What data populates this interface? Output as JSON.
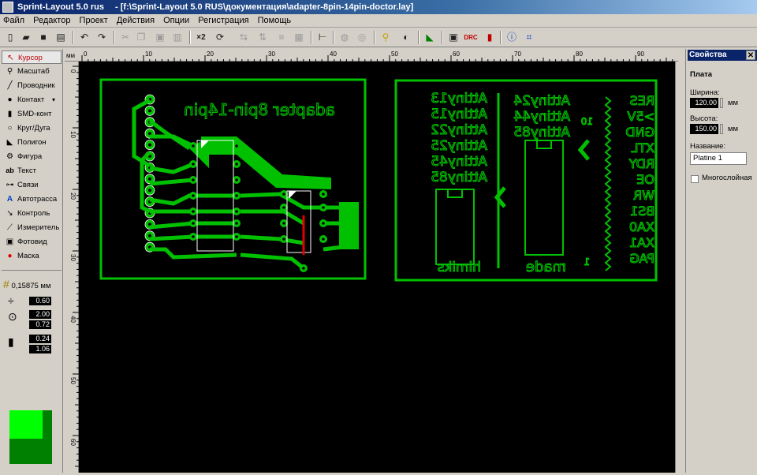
{
  "window": {
    "app_name": "Sprint-Layout 5.0 rus",
    "document_path": "- [f:\\Sprint-Layout 5.0 RUS\\документация\\adapter-8pin-14pin-doctor.lay]"
  },
  "menu": [
    "Файл",
    "Редактор",
    "Проект",
    "Действия",
    "Опции",
    "Регистрация",
    "Помощь"
  ],
  "tools": [
    {
      "label": "Курсор",
      "icon": "cursor-icon"
    },
    {
      "label": "Масштаб",
      "icon": "zoom-icon"
    },
    {
      "label": "Проводник",
      "icon": "track-icon"
    },
    {
      "label": "Контакт",
      "icon": "pad-icon"
    },
    {
      "label": "SMD-конт",
      "icon": "smd-pad-icon"
    },
    {
      "label": "Круг/Дуга",
      "icon": "circle-icon"
    },
    {
      "label": "Полигон",
      "icon": "polygon-icon"
    },
    {
      "label": "Фигура",
      "icon": "shape-icon"
    },
    {
      "label": "Текст",
      "icon": "text-icon"
    },
    {
      "label": "Связи",
      "icon": "connections-icon"
    },
    {
      "label": "Автотрасса",
      "icon": "autoroute-icon"
    },
    {
      "label": "Контроль",
      "icon": "check-icon"
    },
    {
      "label": "Измеритель",
      "icon": "measure-icon"
    },
    {
      "label": "Фотовид",
      "icon": "photoview-icon"
    },
    {
      "label": "Маска",
      "icon": "mask-icon"
    }
  ],
  "grid": {
    "value": "0,15875 мм"
  },
  "track_width": "0.60",
  "pad_outer": "2.00",
  "pad_inner": "0.72",
  "smd_w": "0.24",
  "smd_h": "1.06",
  "colors": {
    "board_bg": "#000000",
    "copper": "#00c000",
    "copper_bright": "#00ff00",
    "silk": "#ffffff",
    "accent_red": "#e00000"
  },
  "ruler": {
    "unit": "мм",
    "top_labels": [
      "0",
      "10",
      "20",
      "30",
      "40",
      "50",
      "60",
      "70",
      "80",
      "90"
    ],
    "left_labels": [
      "0",
      "10",
      "20",
      "30",
      "40",
      "50",
      "60"
    ]
  },
  "board": {
    "left_title": "adapter 8pin-14pin",
    "left_attiny": [
      "Attiny13",
      "Attiny15",
      "Attiny22",
      "Attiny25",
      "Attiny45",
      "Attiny85"
    ],
    "left_signature": "himiks",
    "right_attiny": [
      "Attiny24",
      "Attiny44",
      "Attiny85"
    ],
    "right_made": "made",
    "pin_10": "10",
    "pin_1": "1",
    "signals": [
      "RES",
      ">5V",
      "GND",
      "XTL",
      "RDY",
      "OE",
      "WR",
      "BS1",
      "XA0",
      "XA1",
      "PAG"
    ]
  },
  "props": {
    "title": "Свойства",
    "section": "Плата",
    "width_label": "Ширина:",
    "width_value": "120.00",
    "height_label": "Высота:",
    "height_value": "150.00",
    "unit": "мм",
    "name_label": "Название:",
    "name_value": "Platine 1",
    "multilayer_label": "Многослойная"
  }
}
